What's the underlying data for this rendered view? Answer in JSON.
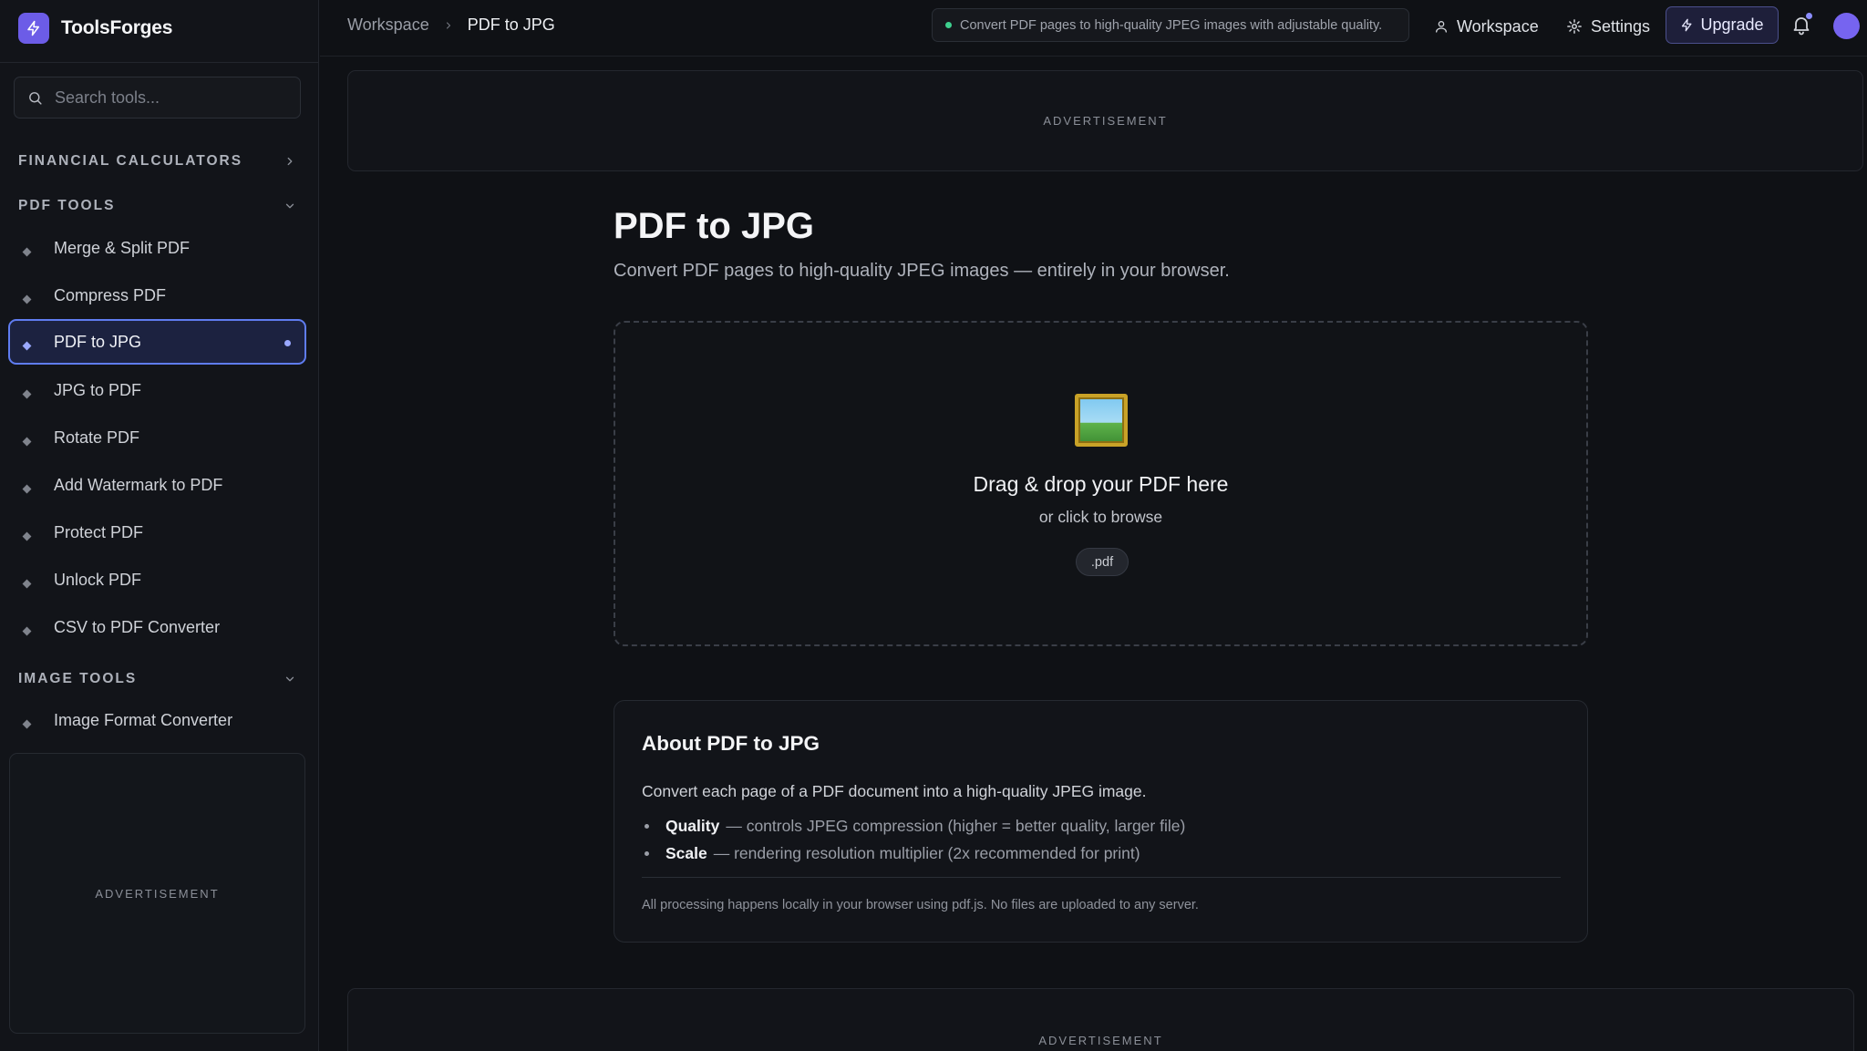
{
  "app": {
    "name": "ToolsForges"
  },
  "search": {
    "placeholder": "Search tools..."
  },
  "sidebar": {
    "sections": [
      {
        "title": "FINANCIAL CALCULATORS",
        "expanded": false
      },
      {
        "title": "PDF TOOLS",
        "expanded": true,
        "items": [
          {
            "label": "Merge & Split PDF"
          },
          {
            "label": "Compress PDF"
          },
          {
            "label": "PDF to JPG",
            "active": true
          },
          {
            "label": "JPG to PDF"
          },
          {
            "label": "Rotate PDF"
          },
          {
            "label": "Add Watermark to PDF"
          },
          {
            "label": "Protect PDF"
          },
          {
            "label": "Unlock PDF"
          },
          {
            "label": "CSV to PDF Converter"
          }
        ]
      },
      {
        "title": "IMAGE TOOLS",
        "expanded": true,
        "items": [
          {
            "label": "Image Format Converter"
          }
        ]
      }
    ],
    "ad_label": "ADVERTISEMENT"
  },
  "header": {
    "breadcrumb": {
      "parent": "Workspace",
      "current": "PDF to JPG"
    },
    "status": "Convert PDF pages to high-quality JPEG images with adjustable quality.",
    "workspace_label": "Workspace",
    "settings_label": "Settings",
    "upgrade_label": "Upgrade"
  },
  "main": {
    "ad_label": "ADVERTISEMENT",
    "title": "PDF to JPG",
    "subtitle": "Convert PDF pages to high-quality JPEG images — entirely in your browser.",
    "dropzone": {
      "title": "Drag & drop your PDF here",
      "subtitle": "or click to browse",
      "accept": ".pdf"
    },
    "about": {
      "title": "About PDF to JPG",
      "description": "Convert each page of a PDF document into a high-quality JPEG image.",
      "items": [
        {
          "term": "Quality",
          "text": "— controls JPEG compression (higher = better quality, larger file)"
        },
        {
          "term": "Scale",
          "text": "— rendering resolution multiplier (2x recommended for print)"
        }
      ],
      "note": "All processing happens locally in your browser using pdf.js. No files are uploaded to any server."
    }
  },
  "colors": {
    "accent": "#6c5ce7",
    "active_border": "#5f7cf0",
    "status": "#3ecf8e"
  }
}
